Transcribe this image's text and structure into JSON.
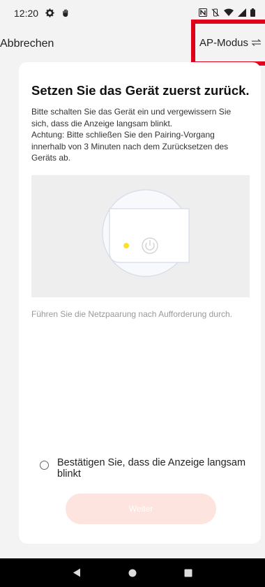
{
  "status_bar": {
    "time": "12:20",
    "icons": [
      "gear-icon",
      "hand-icon",
      "nfc-icon",
      "vibrate-off-icon",
      "wifi-icon",
      "signal-icon",
      "battery-icon"
    ]
  },
  "header": {
    "cancel_label": "Abbrechen",
    "mode_label": "AP-Modus",
    "mode_icon": "swap-icon",
    "highlight_color": "#e0001b"
  },
  "card": {
    "title": "Setzen Sie das Gerät zuerst zurück.",
    "desc_line1": "Bitte schalten Sie das Gerät ein und vergewissern Sie sich, dass die Anzeige langsam blinkt.",
    "desc_line2": "Achtung: Bitte schließen Sie den Pairing-Vorgang innerhalb von 3 Minuten nach dem Zurücksetzen des Geräts ab.",
    "note": "Führen Sie die Netzpaarung nach Aufforderung durch.",
    "confirm_label": "Bestätigen Sie, dass die Anzeige langsam blinkt",
    "next_label": "Weiter",
    "indicator_color": "#f7e22a"
  },
  "nav_bar": {
    "icons": [
      "back-icon",
      "home-icon",
      "recents-icon"
    ]
  }
}
